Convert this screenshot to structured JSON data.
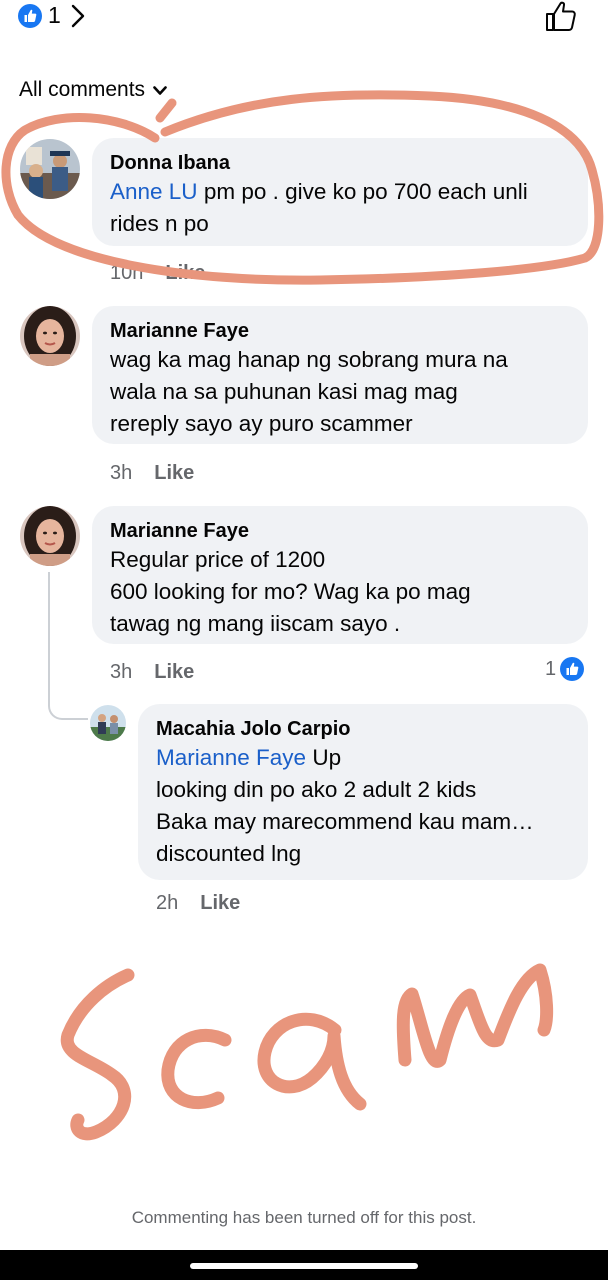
{
  "header": {
    "reaction_count": "1",
    "icons": [
      "like-reaction-icon",
      "chevron-right-icon",
      "like-outline-icon"
    ]
  },
  "filter": {
    "label": "All comments",
    "icon": "chevron-down-icon"
  },
  "comments": [
    {
      "author": "Donna Ibana",
      "mention": "Anne LU",
      "text": " pm po . give ko po 700 each  unli rides n po",
      "time": "10h",
      "like_label": "Like"
    },
    {
      "author": "Marianne Faye",
      "text_lines": [
        "wag ka mag hanap ng sobrang mura na",
        "wala na sa puhunan kasi mag mag",
        "rereply sayo ay puro scammer"
      ],
      "time": "3h",
      "like_label": "Like"
    },
    {
      "author": "Marianne Faye",
      "text_lines": [
        "Regular price of 1200",
        "600 looking for mo? Wag ka po mag",
        "tawag ng mang iiscam sayo ."
      ],
      "time": "3h",
      "like_label": "Like",
      "reaction_count": "1"
    }
  ],
  "reply": {
    "author": "Macahia Jolo Carpio",
    "mention": "Marianne Faye",
    "first_line_rest": " Up",
    "text_lines": [
      "looking din po ako 2 adult 2 kids",
      "Baka may marecommend kau mam…",
      "discounted lng"
    ],
    "time": "2h",
    "like_label": "Like"
  },
  "annotation": {
    "handwritten_text": "Scam",
    "color": "#e8957c"
  },
  "footer": {
    "note": "Commenting has been turned off for this post."
  },
  "colors": {
    "accent": "#1877f2",
    "mention": "#1a5fc9",
    "bubble": "#f0f2f5",
    "meta": "#65676b"
  }
}
